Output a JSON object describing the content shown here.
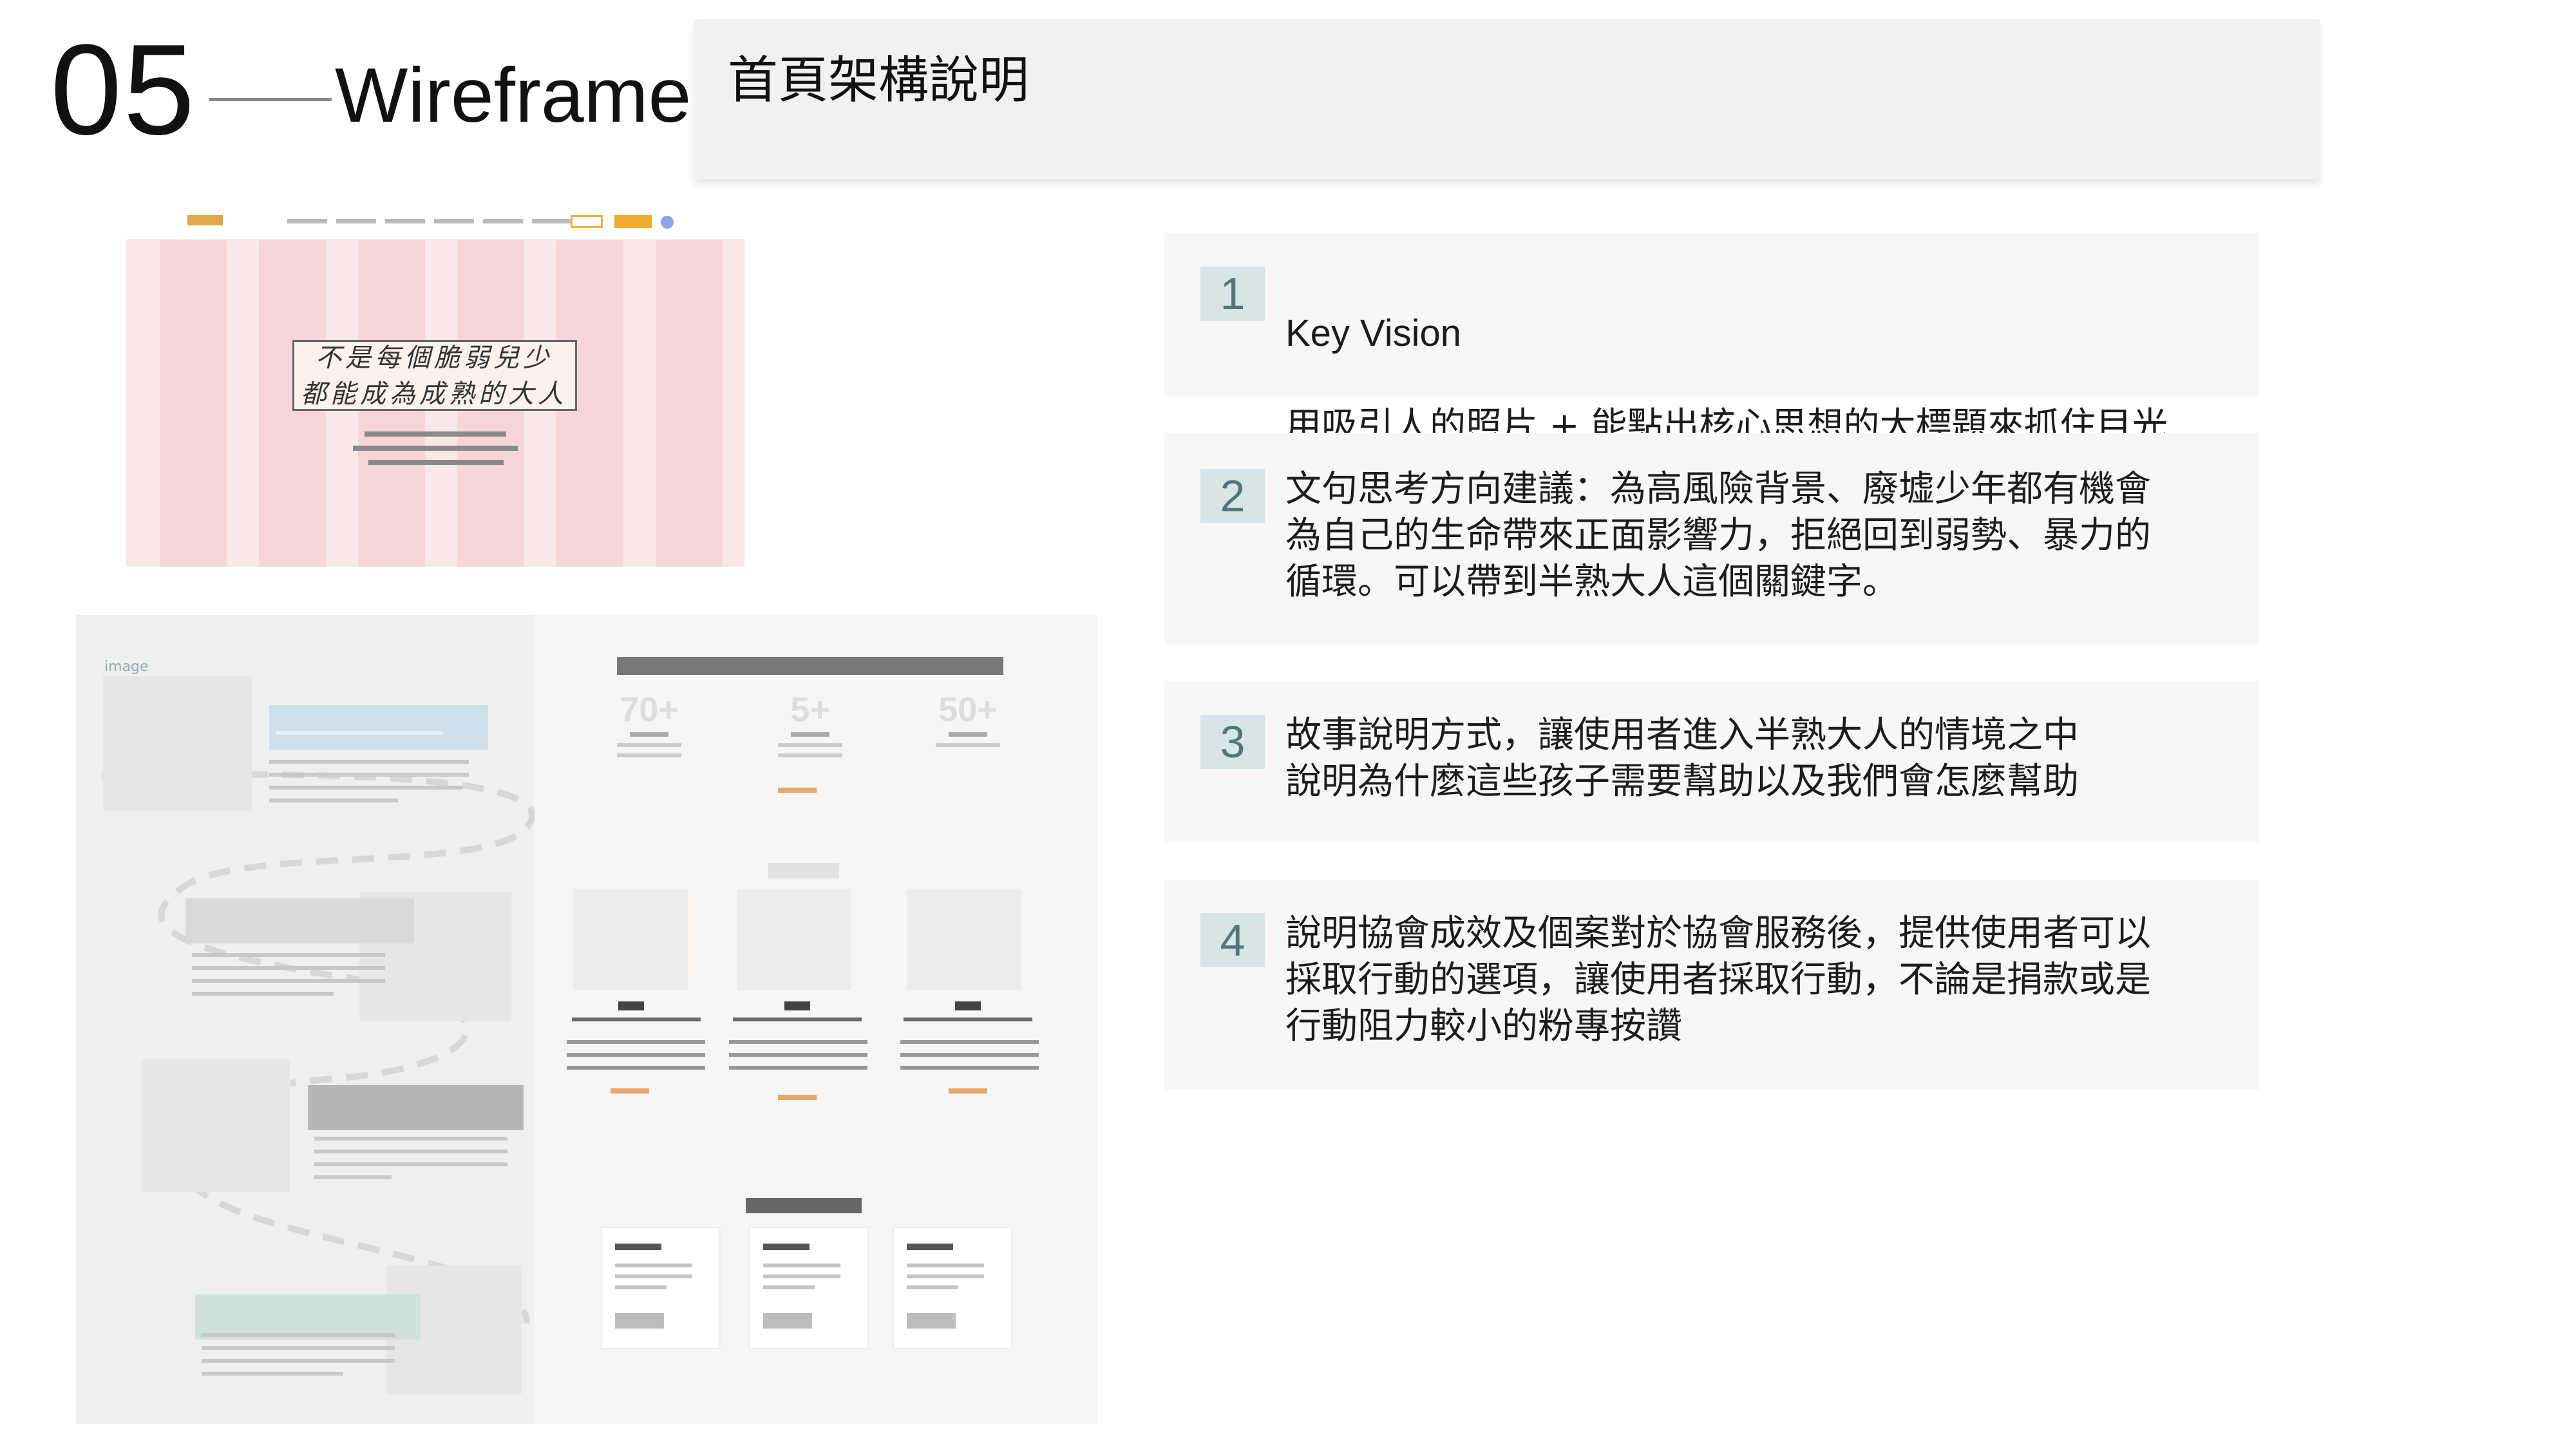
{
  "header": {
    "slide_number": "05",
    "section_title": "Wireframe",
    "heading": "首頁架構說明"
  },
  "wireframe_key_vision": {
    "headline": "不是每個脆弱兒少\n都能成為成熟的大人"
  },
  "wireframe_page": {
    "image_label": "image",
    "stats": [
      "70+",
      "5+",
      "50+"
    ]
  },
  "explanations": [
    {
      "number": "1",
      "title": "Key Vision",
      "text": "用吸引人的照片 + 能點出核心思想的大標題來抓住目光"
    },
    {
      "number": "2",
      "text": "文句思考方向建議：為高風險背景、廢墟少年都有機會\n為自己的生命帶來正面影響力，拒絕回到弱勢、暴力的\n循環。可以帶到半熟大人這個關鍵字。"
    },
    {
      "number": "3",
      "text": "故事說明方式，讓使用者進入半熟大人的情境之中\n說明為什麼這些孩子需要幫助以及我們會怎麼幫助"
    },
    {
      "number": "4",
      "text": "說明協會成效及個案對於協會服務後，提供使用者可以\n採取行動的選項，讓使用者採取行動，不論是捐款或是\n行動阻力較小的粉專按讚"
    }
  ]
}
